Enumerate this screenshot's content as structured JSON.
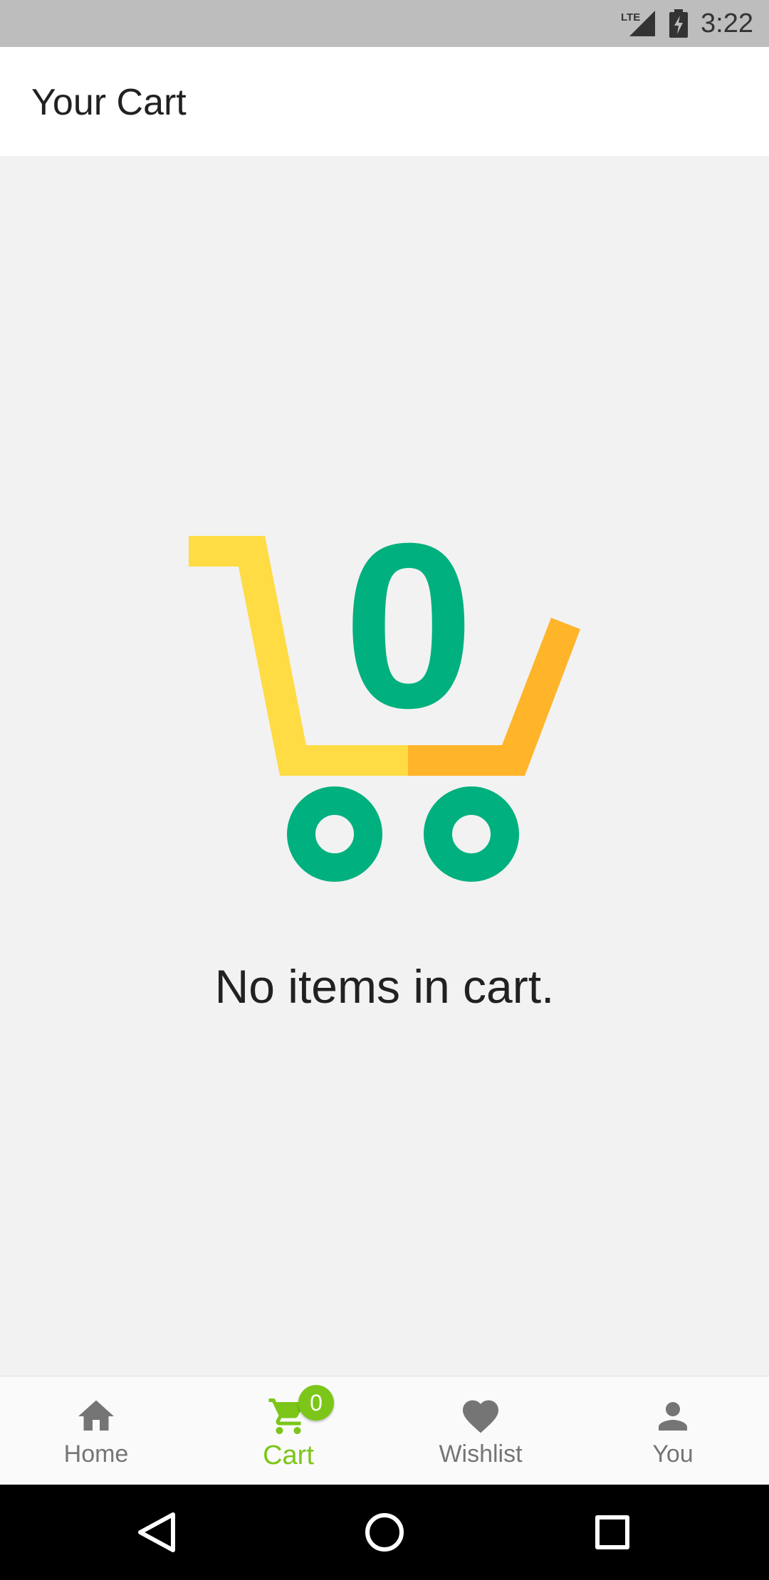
{
  "status_bar": {
    "network": "LTE",
    "time": "3:22"
  },
  "header": {
    "title": "Your Cart"
  },
  "main": {
    "empty_message": "No items in cart.",
    "illustration_count": "0",
    "colors": {
      "cart_yellow": "#FFDB44",
      "cart_orange": "#FFB42A",
      "cart_green": "#00B07E"
    }
  },
  "bottom_nav": {
    "items": [
      {
        "label": "Home",
        "icon": "home-icon"
      },
      {
        "label": "Cart",
        "icon": "cart-icon",
        "badge": "0",
        "active": true
      },
      {
        "label": "Wishlist",
        "icon": "heart-icon"
      },
      {
        "label": "You",
        "icon": "person-icon"
      }
    ],
    "active_color": "#7BC618",
    "inactive_color": "#757575"
  },
  "system_nav": {
    "buttons": [
      "back-icon",
      "home-circle-icon",
      "recents-icon"
    ]
  }
}
